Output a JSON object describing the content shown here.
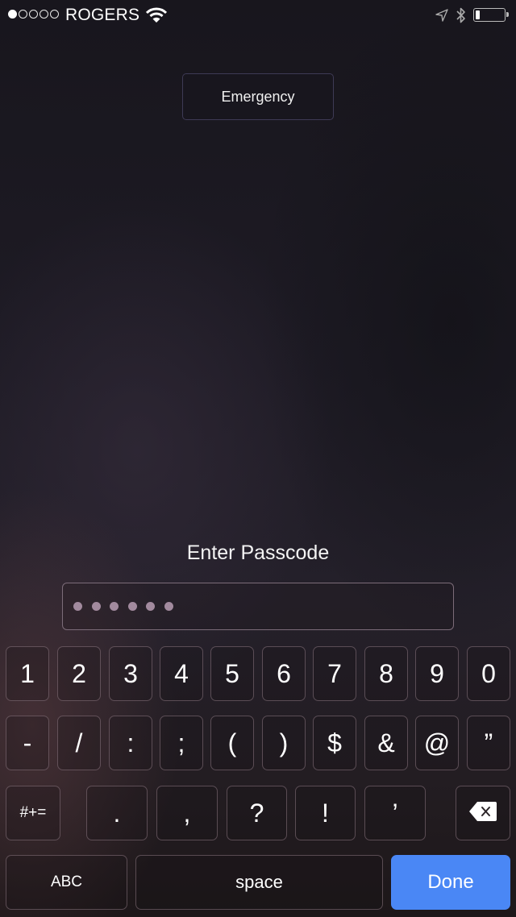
{
  "status_bar": {
    "signal_strength": 1,
    "signal_max": 5,
    "carrier": "ROGERS",
    "icons": [
      "wifi-icon",
      "location-arrow-icon",
      "bluetooth-icon",
      "battery-icon"
    ],
    "battery_level_percent": 15
  },
  "emergency_button": {
    "label": "Emergency"
  },
  "passcode": {
    "prompt": "Enter Passcode",
    "entered_digits_count": 6
  },
  "keyboard": {
    "row1": [
      "1",
      "2",
      "3",
      "4",
      "5",
      "6",
      "7",
      "8",
      "9",
      "0"
    ],
    "row2": [
      "-",
      "/",
      ":",
      ";",
      "(",
      ")",
      "$",
      "&",
      "@",
      "”"
    ],
    "row3": {
      "shift_label": "#+=",
      "keys": [
        ".",
        ",",
        "?",
        "!",
        "’"
      ],
      "delete_icon": "backspace-icon"
    },
    "row4": {
      "abc_label": "ABC",
      "space_label": "space",
      "done_label": "Done"
    }
  },
  "colors": {
    "done_button": "#4a87f5",
    "passcode_dot": "#a28a9e",
    "emergency_border": "#3e3a55"
  }
}
